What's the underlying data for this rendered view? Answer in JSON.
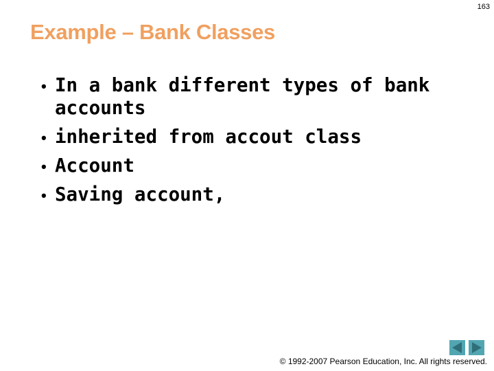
{
  "slide": {
    "number": "163",
    "title": "Example – Bank Classes",
    "bullets": [
      {
        "text": "In a bank different types of bank accounts"
      },
      {
        "text": "inherited from accout class"
      },
      {
        "text": "Account"
      },
      {
        "text": "Saving account,"
      }
    ],
    "bullet_glyph": "•"
  },
  "navigation": {
    "prev_icon": "triangle-left-icon",
    "next_icon": "triangle-right-icon"
  },
  "footer": {
    "copyright": "© 1992-2007 Pearson Education, Inc.  All rights reserved."
  },
  "colors": {
    "title": "#f0a060",
    "nav_background": "#52a6b1",
    "nav_arrow": "#2f6f7a"
  }
}
